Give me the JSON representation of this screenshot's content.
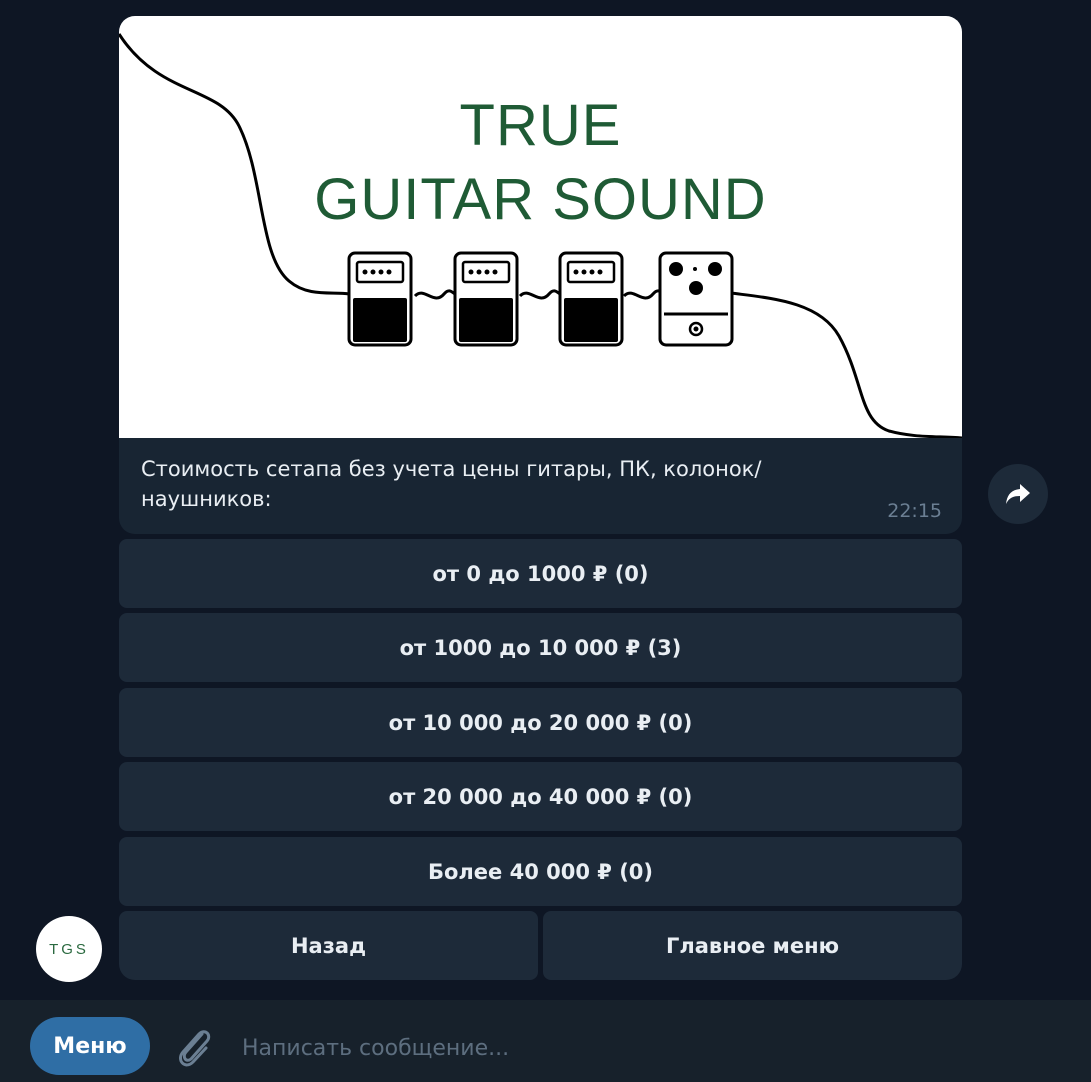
{
  "banner": {
    "title_line1": "TRUE",
    "title_line2": "GUITAR SOUND",
    "brand_color": "#1f5b35"
  },
  "message": {
    "caption": "Стоимость сетапа без учета цены гитары, ПК, колонок/ наушников:",
    "time": "22:15"
  },
  "share": {
    "icon": "share-arrow-icon"
  },
  "keyboard": {
    "options": [
      {
        "label": "от 0 до 1000 ₽ (0)"
      },
      {
        "label": "от 1000 до 10 000 ₽ (3)"
      },
      {
        "label": "от 10 000 до 20 000 ₽ (0)"
      },
      {
        "label": "от 20 000 до 40 000 ₽ (0)"
      },
      {
        "label": "Более 40 000 ₽ (0)"
      }
    ],
    "back_label": "Назад",
    "main_menu_label": "Главное меню"
  },
  "avatar": {
    "text": "TGS"
  },
  "composer": {
    "menu_label": "Меню",
    "attach_icon": "paperclip-icon",
    "placeholder": "Написать сообщение..."
  },
  "colors": {
    "chat_bg": "#0e1624",
    "bubble": "#182533",
    "button": "#1d2a39",
    "accent": "#2f6ea5"
  }
}
